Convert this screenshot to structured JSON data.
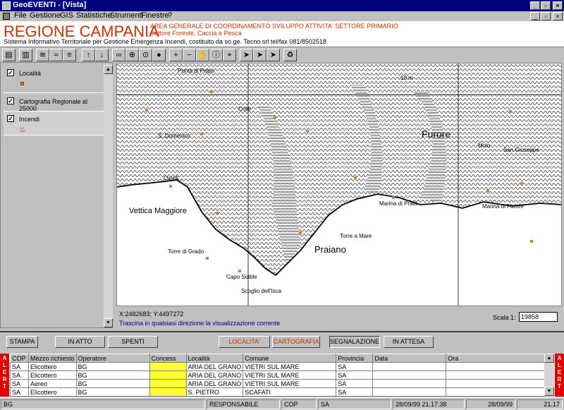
{
  "window": {
    "title": "GeoEVENTI - [Vista]"
  },
  "menu": [
    "File",
    "Gestione",
    "GIS",
    "Statistiche",
    "Strumenti",
    "Finestre",
    "?"
  ],
  "header": {
    "region": "REGIONE CAMPANIA",
    "line1": "AREA GENERALE DI COORDINAMENTO SVILUPPO ATTIVITA' SETTORE PRIMARIO",
    "line2": "Settore Foreste, Caccia e Pesca",
    "line3": "Sistema Informativo Territoriale per Gestione Emergenza Incendi, costituito da so.ge. Tecno srl  tel/fax 081/8502518"
  },
  "legend": [
    {
      "label": "Località",
      "checked": true
    },
    {
      "label": "Cartografia Regionale al 25000",
      "checked": true
    },
    {
      "label": "Incendi",
      "checked": true
    }
  ],
  "map": {
    "labels": [
      "Punta di Paipo",
      "Colle",
      "S. Domenico",
      "Osrell...",
      "Vettica Maggiore",
      "Torre di Grado",
      "Capo Sottile",
      "Scoglio dell'Isca",
      "Praiano",
      "Torre a Mare",
      "Marina di Praia",
      "Furore",
      "Molo",
      "San Giuseppe",
      "Marina di Furore",
      "10 m"
    ],
    "coords": "X:2482683;  Y:4497272",
    "hint": "Trascina in qualsiasi direzione la visualizzazione corrente",
    "scale_label": "Scala 1:",
    "scale_value": "19858"
  },
  "buttons": {
    "stampa": "STAMPA",
    "in_atto": "IN ATTO",
    "spenti": "SPENTI",
    "localita": "LOCALITA'",
    "cartografia": "CARTOGRAFIA",
    "segnalazione": "SEGNALAZIONE",
    "in_attesa": "IN ATTESA"
  },
  "table": {
    "alert_label": "ALERT",
    "columns": [
      "COP",
      "Mezzo richiesto",
      "Operatore",
      "Concess",
      "Località",
      "Comune",
      "Provincia",
      "Data",
      "Ora"
    ],
    "rows": [
      [
        "SA",
        "Elicottero",
        "BG",
        "",
        "ARIA DEL GRANO",
        "VIETRI SUL MARE",
        "SA",
        "",
        ""
      ],
      [
        "SA",
        "Elicottero",
        "BG",
        "",
        "ARIA DEL GRANO",
        "VIETRI SUL MARE",
        "SA",
        "",
        ""
      ],
      [
        "SA",
        "Aereo",
        "BG",
        "",
        "ARIA DEL GRANO",
        "VIETRI SUL MARE",
        "SA",
        "",
        ""
      ],
      [
        "SA",
        "Elicottero",
        "BG",
        "",
        "S. PIETRO",
        "SCAFATI",
        "SA",
        "",
        ""
      ]
    ]
  },
  "status": {
    "user": "BG",
    "role": "RESPONSABILE",
    "cop_label": "COP",
    "cop": "SA",
    "datetime": "28/09/99 21.17.38",
    "date": "28/09/99",
    "time": "21.17"
  },
  "colors": {
    "title_bg": "#000080",
    "brand": "#d03000",
    "alert": "#e00000",
    "concess": "#ffff33"
  }
}
